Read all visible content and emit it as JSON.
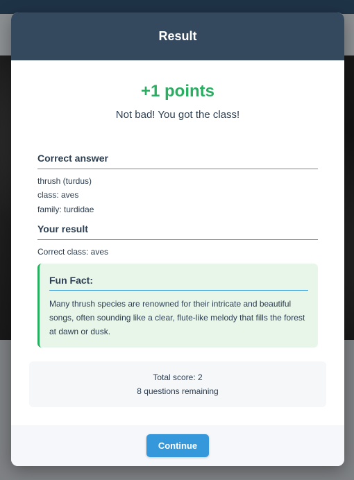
{
  "modal": {
    "title": "Result",
    "points": "+1 points",
    "message": "Not bad! You got the class!"
  },
  "correct_answer": {
    "heading": "Correct answer",
    "lines": [
      "thrush (turdus)",
      "class: aves",
      "family: turdidae"
    ]
  },
  "your_result": {
    "heading": "Your result",
    "lines": [
      "Correct class: aves"
    ]
  },
  "fun_fact": {
    "heading": "Fun Fact:",
    "text": "Many thrush species are renowned for their intricate and beautiful songs, often sounding like a clear, flute-like melody that fills the forest at dawn or dusk."
  },
  "score": {
    "total": "Total score: 2",
    "remaining": "8 questions remaining"
  },
  "footer": {
    "continue_label": "Continue"
  },
  "colors": {
    "header": "#34495e",
    "points": "#27ae60",
    "accent": "#3498db",
    "fun_fact_bg": "#e8f5e9"
  }
}
